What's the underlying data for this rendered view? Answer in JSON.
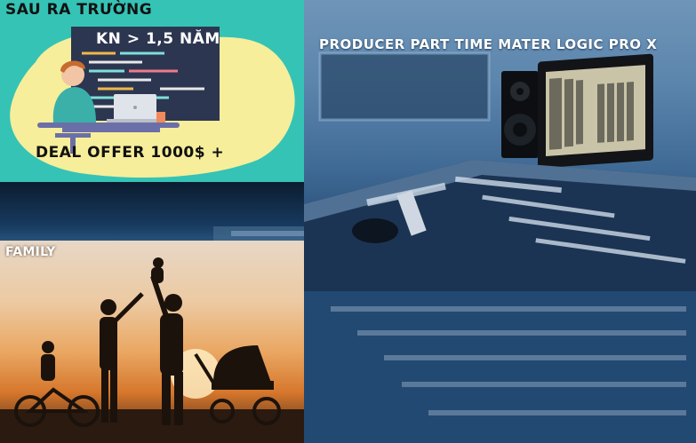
{
  "career": {
    "title": "SAU RA TRƯỜNG",
    "experience": "KN > 1,5 NĂM",
    "deal": "DEAL OFFER 1000$ +"
  },
  "family": {
    "title": "FAMILY"
  },
  "producer": {
    "title": "PRODUCER PART TIME  MATER LOGIC PRO X"
  },
  "colors": {
    "career_bg": "#35c3b6",
    "blob": "#f6ee9a",
    "monitor": "#2c3650",
    "studio_blue": "#3f6a95",
    "sunset": "#eaa762"
  }
}
